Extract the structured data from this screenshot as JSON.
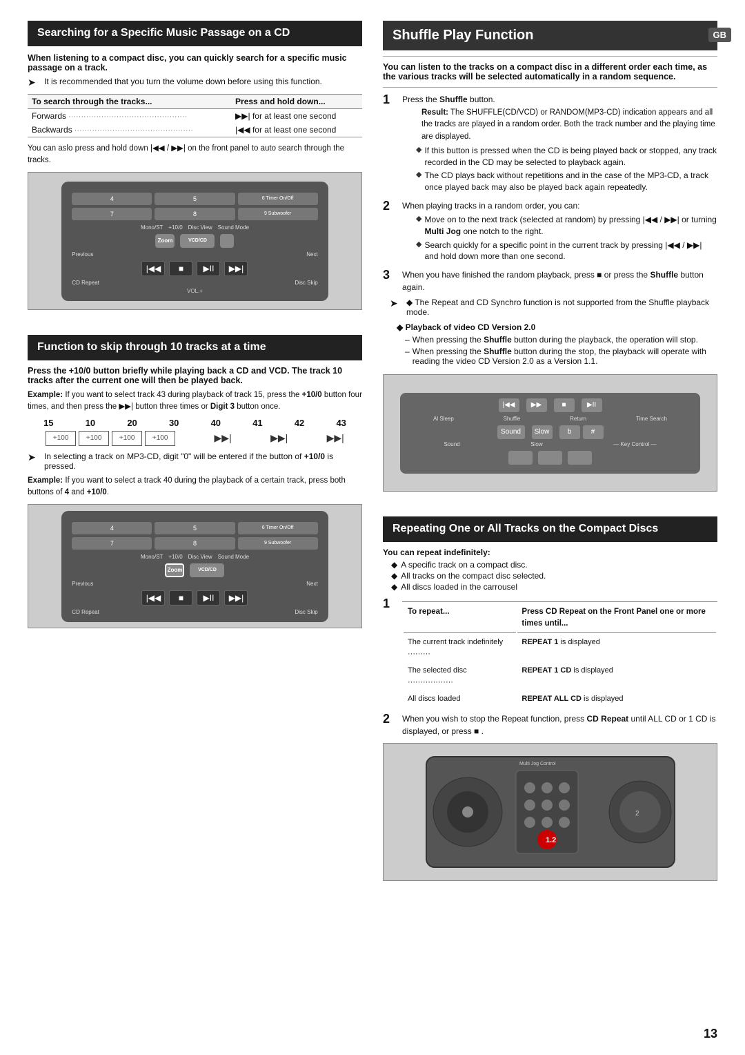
{
  "page": {
    "number": "13",
    "gb_label": "GB"
  },
  "left": {
    "section1": {
      "title": "Searching for a Specific Music Passage on a CD",
      "intro": "When listening to a compact disc, you can quickly search for a specific music passage on a track.",
      "arrow_note": "It is recommended that you turn the volume down before using this function.",
      "table": {
        "col1": "To search through the tracks...",
        "col2": "Press and hold down...",
        "rows": [
          {
            "dir": "Forwards",
            "action": "▶▶| for at least one second"
          },
          {
            "dir": "Backwards",
            "action": "|◀◀ for at least one second"
          }
        ]
      },
      "auto_note": "You can aslo press and hold down |◀◀ / ▶▶| on the front panel to auto search through the tracks."
    },
    "section2": {
      "title": "Function to skip through 10 tracks at a time",
      "intro": "Press the +10/0 button briefly while playing back a CD and VCD. The track 10 tracks after the current one will then be played back.",
      "example1": "Example: If you want to select track 43 during playback of track 15, press the +10/0 button four times, and then press the ▶▶| button three times or Digit 3 button once.",
      "track_numbers": [
        "15",
        "10",
        "20",
        "30",
        "40",
        "41",
        "42",
        "43"
      ],
      "track_labels": [
        "+100",
        "+100",
        "+100",
        "+100"
      ],
      "arrow_note2": "In selecting a track on MP3-CD, digit \"0\" will be entered if the button of +10/0 is pressed.",
      "example2": "Example: If you want to select a track 40 during the playback of a certain track, press both buttons of 4 and +10/0."
    }
  },
  "right": {
    "section1": {
      "title": "Shuffle Play Function",
      "intro": "You can listen to the tracks on a compact disc in a different order each time, as the various tracks will be selected automatically in a random sequence.",
      "steps": [
        {
          "num": "1",
          "text": "Press the Shuffle button.",
          "result": "Result: The SHUFFLE(CD/VCD) or RANDOM(MP3-CD) indication appears and all the tracks are played in a random order. Both the track number and the playing time are displayed.",
          "bullets": [
            "If this button is pressed when the CD is being played back or stopped, any track recorded in the CD may be selected to playback again.",
            "The CD plays back without repetitions and in the case of the MP3-CD, a track once played back may also be played back again repeatedly."
          ]
        },
        {
          "num": "2",
          "text": "When playing tracks in a random order, you can:",
          "bullets": [
            "Move on to the next track (selected at random) by pressing |◀◀ / ▶▶| or turning Multi Jog one notch to the right.",
            "Search quickly for a specific point in the current track by pressing |◀◀ / ▶▶| and hold down more than one second."
          ]
        },
        {
          "num": "3",
          "text": "When you have finished the random playback, press ■ or press the Shuffle button again."
        }
      ],
      "note": "◆ The Repeat and CD Synchro function is not supported from the Shuffle playback mode.",
      "playback_header": "◆ Playback of video CD Version 2.0",
      "playback_items": [
        "– When pressing the Shuffle button during the playback, the operation will stop.",
        "– When pressing the Shuffle button during the stop, the playback will operate with reading the video CD Version 2.0 as a Version 1.1."
      ]
    },
    "section2": {
      "title": "Repeating One or All Tracks on the Compact Discs",
      "you_can": "You can repeat indefinitely:",
      "bullets": [
        "A specific track on a compact disc.",
        "All tracks on the compact disc selected.",
        "All discs loaded in the carrousel"
      ],
      "steps": [
        {
          "num": "1",
          "col1": "To repeat...",
          "col2": "Press CD Repeat on the Front Panel one or more times until...",
          "rows": [
            {
              "action": "The current track indefinitely",
              "result": "REPEAT 1 is displayed"
            },
            {
              "action": "The selected disc",
              "result": "REPEAT 1 CD is displayed"
            },
            {
              "action": "All discs loaded",
              "result": "REPEAT ALL CD is displayed"
            }
          ]
        },
        {
          "num": "2",
          "text": "When you wish to stop the Repeat function, press CD Repeat until ALL CD or 1 CD is displayed, or press ■ ."
        }
      ]
    }
  }
}
